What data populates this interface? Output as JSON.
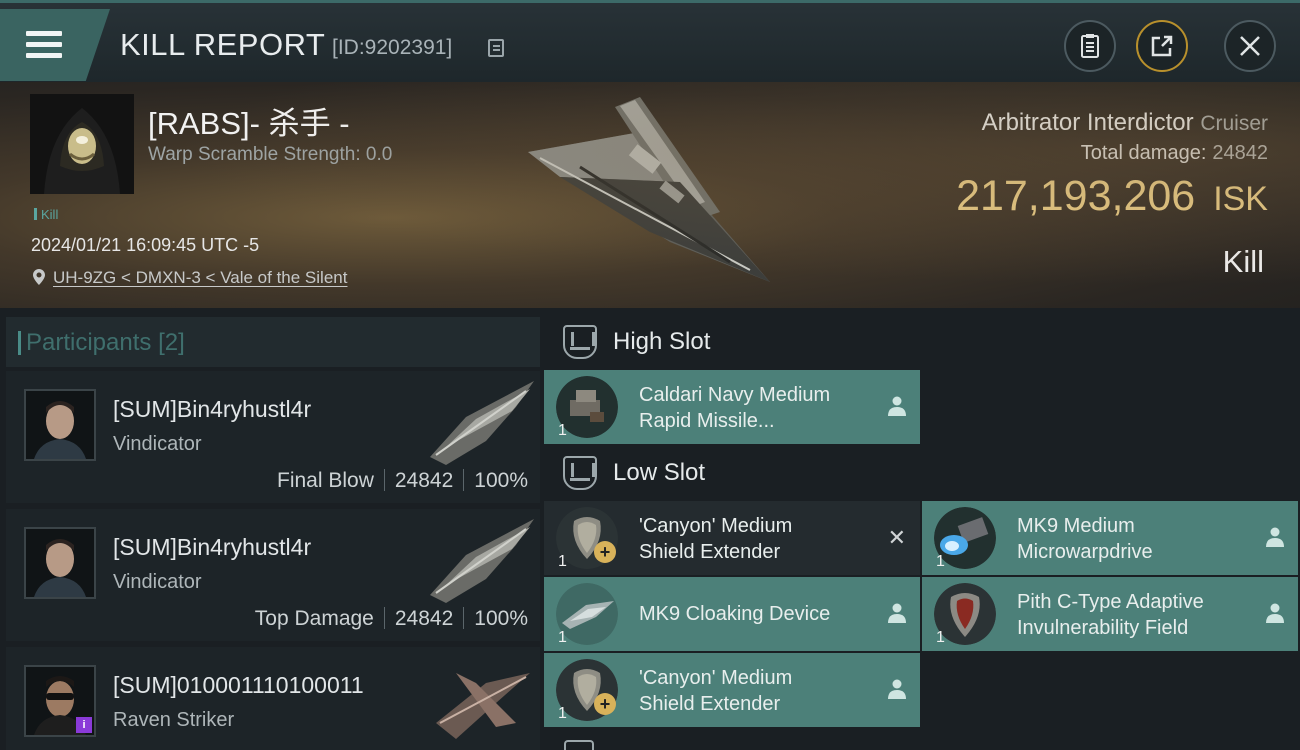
{
  "header": {
    "title": "KILL REPORT",
    "report_id": "[ID:9202391]"
  },
  "victim": {
    "name": "[RABS]- 杀手 -",
    "warp_scramble": "Warp Scramble Strength: 0.0",
    "tag": "Kill",
    "datetime": "2024/01/21 16:09:45 UTC -5",
    "location": "UH-9ZG < DMXN-3 < Vale of the Silent",
    "ship": "Arbitrator Interdictor",
    "ship_class": "Cruiser",
    "total_damage_label": "Total damage:",
    "total_damage": "24842",
    "isk_value": "217,193,206",
    "isk_unit": "ISK",
    "result": "Kill"
  },
  "participants": {
    "label": "Participants",
    "count": "[2]",
    "items": [
      {
        "name": "[SUM]Bin4ryhustl4r",
        "ship": "Vindicator",
        "role": "Final Blow",
        "damage": "24842",
        "percent": "100%"
      },
      {
        "name": "[SUM]Bin4ryhustl4r",
        "ship": "Vindicator",
        "role": "Top Damage",
        "damage": "24842",
        "percent": "100%"
      },
      {
        "name": "[SUM]010001110100011",
        "ship": "Raven Striker"
      }
    ]
  },
  "fitting": {
    "high_slot": {
      "title": "High Slot",
      "modules": [
        {
          "name_line1": "Caldari Navy Medium",
          "name_line2": "Rapid Missile...",
          "qty": "1"
        }
      ]
    },
    "low_slot": {
      "title": "Low Slot",
      "modules": [
        {
          "name_line1": "'Canyon' Medium",
          "name_line2": "Shield Extender",
          "qty": "1"
        },
        {
          "name_line1": "MK9 Medium",
          "name_line2": "Microwarpdrive",
          "qty": "1"
        },
        {
          "name_line1": "MK9 Cloaking Device",
          "qty": "1"
        },
        {
          "name_line1": "Pith C-Type Adaptive",
          "name_line2": "Invulnerability Field",
          "qty": "1"
        },
        {
          "name_line1": "'Canyon' Medium",
          "name_line2": "Shield Extender",
          "qty": "1"
        }
      ]
    }
  },
  "colors": {
    "accent_teal": "#4c8079",
    "isk_gold": "#ecd08a",
    "share_ring": "#b8902c"
  },
  "icons": [
    "menu-icon",
    "copy-icon",
    "clipboard-icon",
    "share-icon",
    "close-icon",
    "location-pin-icon",
    "slot-icon",
    "person-icon",
    "remove-icon",
    "plus-icon"
  ]
}
